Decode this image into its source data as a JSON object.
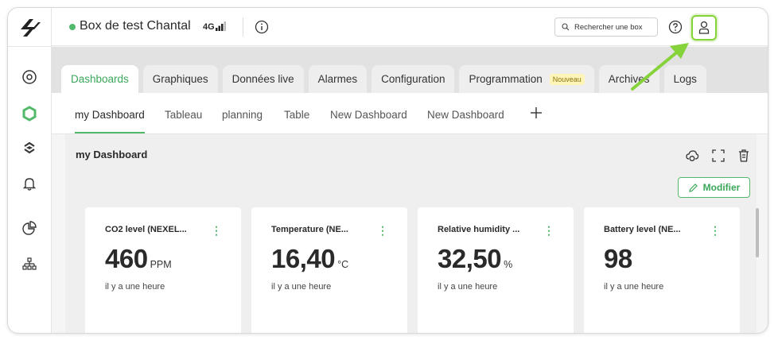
{
  "header": {
    "box_name": "Box de test Chantal",
    "network": "4G",
    "search_placeholder": "Rechercher une box"
  },
  "colors": {
    "accent": "#53b96a",
    "highlight": "#86d23a",
    "badge_bg": "#fff5b8"
  },
  "sidebar": {
    "items": [
      {
        "icon": "location-icon"
      },
      {
        "icon": "dashboard-hex-icon",
        "active": true
      },
      {
        "icon": "layers-icon"
      },
      {
        "icon": "bell-icon"
      },
      {
        "icon": "pie-chart-icon"
      },
      {
        "icon": "network-tree-icon"
      }
    ]
  },
  "main_tabs": {
    "items": [
      {
        "label": "Dashboards"
      },
      {
        "label": "Graphiques"
      },
      {
        "label": "Données live"
      },
      {
        "label": "Alarmes"
      },
      {
        "label": "Configuration"
      },
      {
        "label": "Programmation",
        "badge": "Nouveau"
      },
      {
        "label": "Archives"
      },
      {
        "label": "Logs"
      }
    ]
  },
  "sub_tabs": {
    "items": [
      {
        "label": "my Dashboard"
      },
      {
        "label": "Tableau"
      },
      {
        "label": "planning"
      },
      {
        "label": "Table"
      },
      {
        "label": "New Dashboard"
      },
      {
        "label": "New Dashboard"
      }
    ]
  },
  "dashboard": {
    "title": "my Dashboard",
    "modify_label": "Modifier",
    "cards": [
      {
        "title": "CO2 level (NEXEL...",
        "value": "460",
        "unit": "PPM",
        "time": "il y a une heure"
      },
      {
        "title": "Temperature (NE...",
        "value": "16,40",
        "unit": "°C",
        "time": "il y a une heure"
      },
      {
        "title": "Relative humidity ...",
        "value": "32,50",
        "unit": "%",
        "time": "il y a une heure"
      },
      {
        "title": "Battery level (NE...",
        "value": "98",
        "unit": "",
        "time": "il y a une heure"
      }
    ]
  }
}
